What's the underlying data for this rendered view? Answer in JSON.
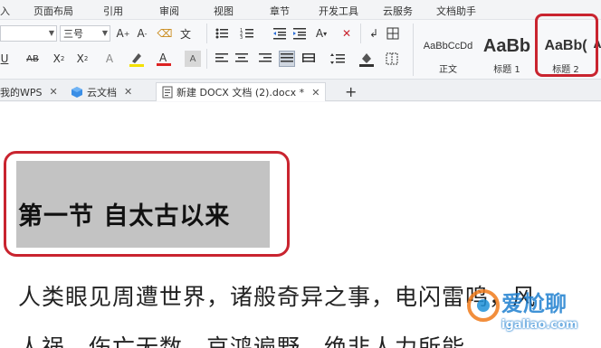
{
  "menu": {
    "items": [
      "入",
      "页面布局",
      "引用",
      "审阅",
      "视图",
      "章节",
      "开发工具",
      "云服务",
      "文档助手"
    ]
  },
  "ribbon": {
    "font_size_value": "三号",
    "styles": [
      {
        "preview": "AaBbCcDd",
        "label": "正文"
      },
      {
        "preview": "AaBb",
        "label": "标题 1"
      },
      {
        "preview": "AaBb(",
        "label": "标题 2"
      }
    ]
  },
  "tabs": [
    {
      "label": "我的WPS"
    },
    {
      "label": "云文档"
    },
    {
      "label": "新建 DOCX 文档 (2).docx *"
    }
  ],
  "document": {
    "heading": "第一节  自太古以来",
    "lines": [
      "人类眼见周遭世界，诸般奇异之事，电闪雷鸣，风",
      "人祸，伤亡无数，哀鸿遍野，绝非人力所能"
    ]
  },
  "watermark": {
    "brand": "爱尬聊",
    "url": "igaliao.com"
  },
  "colors": {
    "highlight_border": "#c9242f",
    "heading_shading": "#c3c3c3"
  }
}
